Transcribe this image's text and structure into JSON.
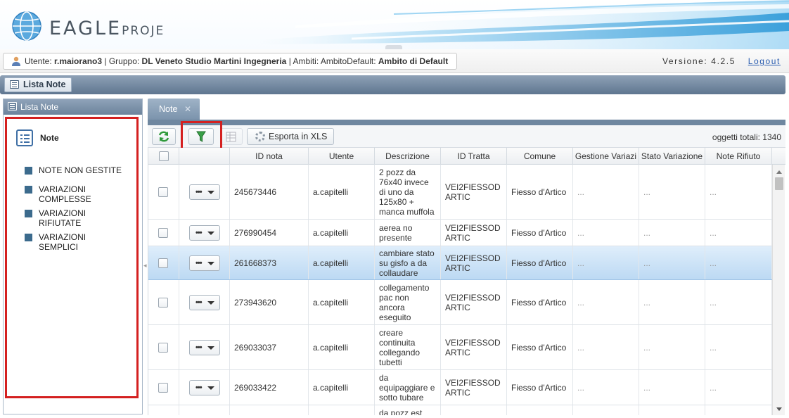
{
  "header": {
    "logo_text_main": "EAGLE",
    "logo_text_small": "PROJE"
  },
  "userbar": {
    "user_prefix": "Utente: ",
    "user": "r.maiorano3",
    "group_prefix": " | Gruppo: ",
    "group": "DL Veneto Studio Martini Ingegneria",
    "scope_prefix": " | Ambiti: AmbitoDefault: ",
    "scope": "Ambito di Default",
    "version": "Versione: 4.2.5",
    "logout": "Logout"
  },
  "module": {
    "title": "Lista Note"
  },
  "left_panel": {
    "title": "Lista Note",
    "root": "Note",
    "items": [
      {
        "label": "NOTE NON GESTITE"
      },
      {
        "label": "VARIAZIONI COMPLESSE"
      },
      {
        "label": "VARIAZIONI RIFIUTATE"
      },
      {
        "label": "VARIAZIONI SEMPLICI"
      }
    ]
  },
  "tabs": [
    {
      "label": "Note",
      "close": "✕"
    }
  ],
  "toolbar": {
    "export_label": "Esporta in XLS",
    "total": "oggetti totali: 1340"
  },
  "grid": {
    "columns": [
      "ID nota",
      "Utente",
      "Descrizione",
      "ID Tratta",
      "Comune",
      "Gestione Variazi",
      "Stato Variazione",
      "Note Rifiuto"
    ],
    "rows": [
      {
        "id": "245673446",
        "user": "a.capitelli",
        "desc": "2 pozz da 76x40 invece di uno da 125x80 + manca muffola",
        "tratta": "VEI2FIESSOD ARTIC",
        "comune": "Fiesso d'Artico",
        "gest": "...",
        "stato": "...",
        "rifiuto": "..."
      },
      {
        "id": "276990454",
        "user": "a.capitelli",
        "desc": "aerea no presente",
        "tratta": "VEI2FIESSOD ARTIC",
        "comune": "Fiesso d'Artico",
        "gest": "...",
        "stato": "...",
        "rifiuto": "..."
      },
      {
        "id": "261668373",
        "user": "a.capitelli",
        "desc": "cambiare stato su gisfo a da collaudare",
        "tratta": "VEI2FIESSOD ARTIC",
        "comune": "Fiesso d'Artico",
        "gest": "...",
        "stato": "...",
        "rifiuto": "...",
        "selected": true
      },
      {
        "id": "273943620",
        "user": "a.capitelli",
        "desc": "collegamento pac non ancora eseguito",
        "tratta": "VEI2FIESSOD ARTIC",
        "comune": "Fiesso d'Artico",
        "gest": "...",
        "stato": "...",
        "rifiuto": "..."
      },
      {
        "id": "269033037",
        "user": "a.capitelli",
        "desc": "creare continuita collegando tubetti",
        "tratta": "VEI2FIESSOD ARTIC",
        "comune": "Fiesso d'Artico",
        "gest": "...",
        "stato": "...",
        "rifiuto": "..."
      },
      {
        "id": "269033422",
        "user": "a.capitelli",
        "desc": "da equipaggiare e sotto tubare",
        "tratta": "VEI2FIESSOD ARTIC",
        "comune": "Fiesso d'Artico",
        "gest": "...",
        "stato": "...",
        "rifiuto": "..."
      },
      {
        "id": "",
        "user": "",
        "desc": "da pozz est",
        "tratta": "",
        "comune": "",
        "gest": "",
        "stato": "",
        "rifiuto": ""
      }
    ],
    "row_menu_label": "•••"
  }
}
